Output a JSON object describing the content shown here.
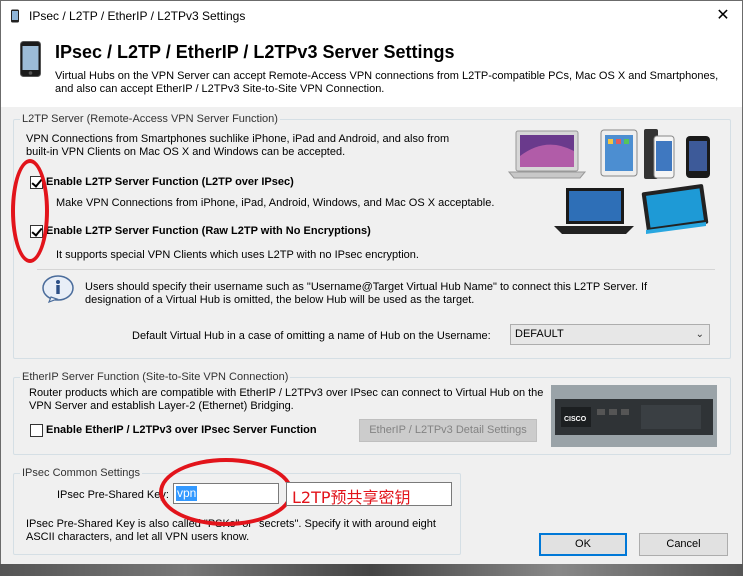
{
  "window": {
    "title": "IPsec / L2TP / EtherIP / L2TPv3 Settings",
    "close_glyph": "✕"
  },
  "header": {
    "title": "IPsec / L2TP / EtherIP / L2TPv3 Server Settings",
    "description": "Virtual Hubs on the VPN Server can accept Remote-Access VPN connections from L2TP-compatible PCs, Mac OS X and Smartphones, and also can accept EtherIP / L2TPv3 Site-to-Site VPN Connection."
  },
  "l2tp": {
    "group_title": "L2TP Server (Remote-Access VPN Server Function)",
    "intro": "VPN Connections from Smartphones suchlike iPhone, iPad and Android, and also from built-in VPN Clients on Mac OS X and Windows can be accepted.",
    "ipsec_checkbox": {
      "label": "Enable L2TP Server Function (L2TP over IPsec)",
      "checked": true
    },
    "ipsec_desc": "Make VPN Connections from iPhone, iPad, Android, Windows, and Mac OS X acceptable.",
    "raw_checkbox": {
      "label": "Enable L2TP Server Function (Raw L2TP with No Encryptions)",
      "checked": true
    },
    "raw_desc": "It supports special VPN Clients which uses L2TP with no IPsec encryption.",
    "info_text": "Users should specify their username such as \"Username@Target Virtual Hub Name\" to connect this L2TP Server. If designation of a Virtual Hub is omitted, the below Hub will be used as the target.",
    "default_hub_label": "Default Virtual Hub in a case of omitting a name of Hub on the Username:",
    "default_hub_value": "DEFAULT"
  },
  "etherip": {
    "group_title": "EtherIP Server Function (Site-to-Site VPN Connection)",
    "intro": "Router products which are compatible with EtherIP / L2TPv3 over IPsec can connect to Virtual Hub on the VPN Server and establish Layer-2 (Ethernet) Bridging.",
    "checkbox": {
      "label": "Enable EtherIP / L2TPv3 over IPsec Server Function",
      "checked": false
    },
    "detail_button": "EtherIP / L2TPv3 Detail Settings"
  },
  "ipsec": {
    "group_title": "IPsec Common Settings",
    "psk_label": "IPsec Pre-Shared Key:",
    "psk_value": "vpn",
    "note": "IPsec Pre-Shared Key is also called \"PSKs\" or \"secrets\". Specify it with around eight ASCII characters, and let all VPN users know."
  },
  "buttons": {
    "ok": "OK",
    "cancel": "Cancel"
  },
  "annotation": {
    "psk_note": "L2TP预共享密钥"
  },
  "colors": {
    "annotation_red": "#e2141b",
    "focus_blue": "#0078d7"
  }
}
